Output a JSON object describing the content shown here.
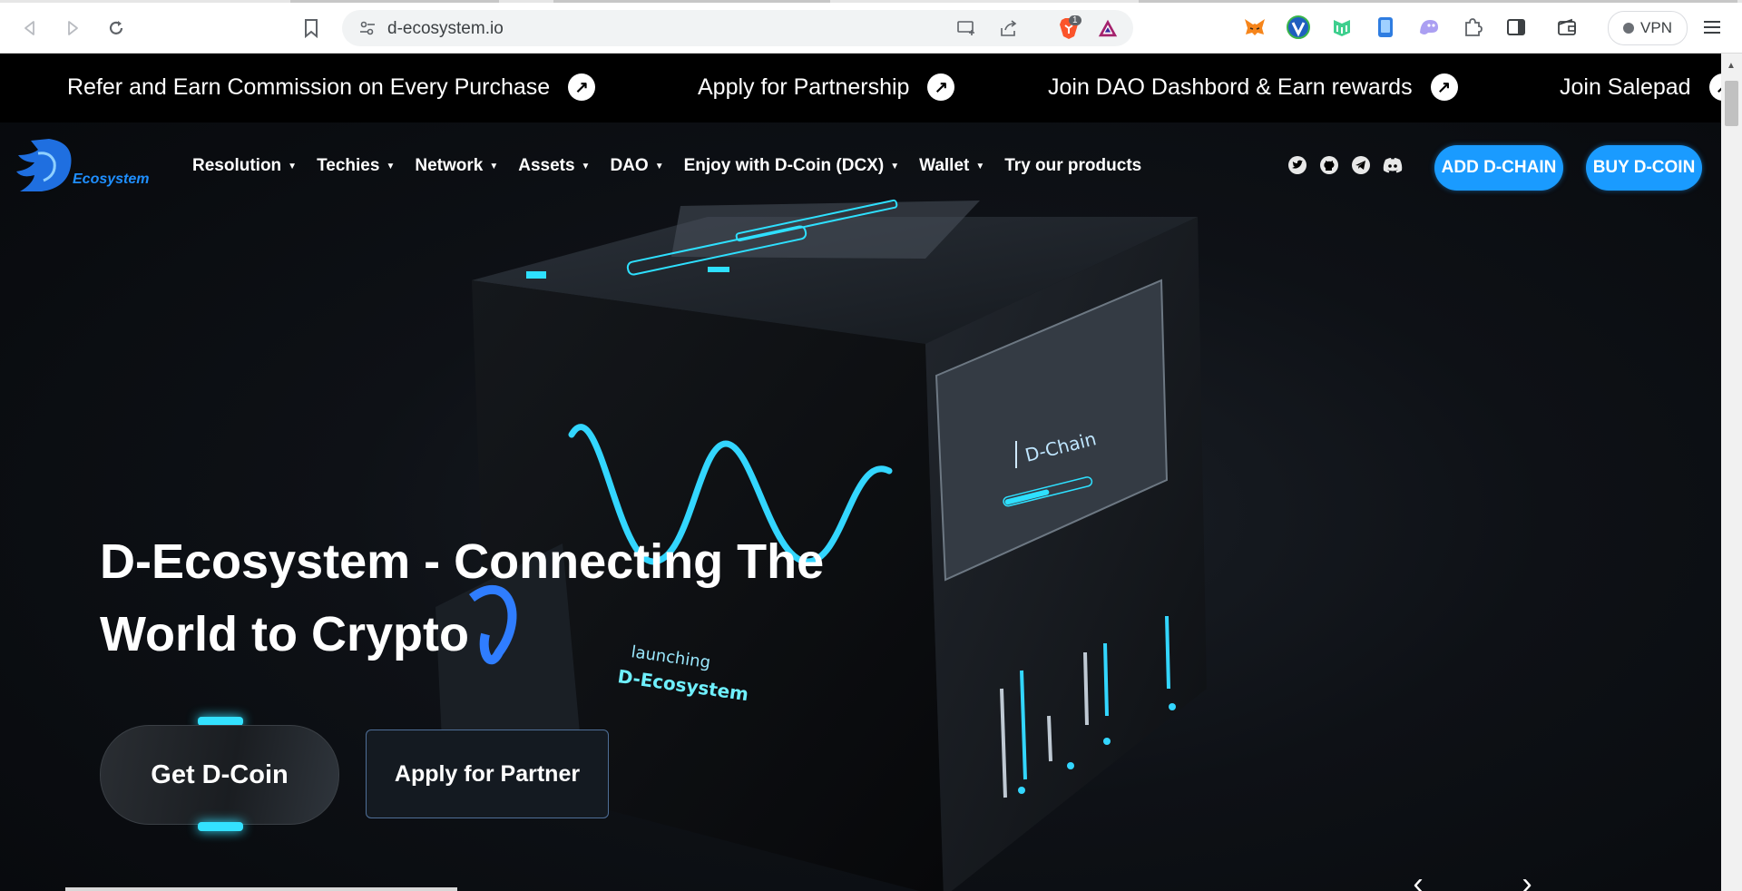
{
  "browser": {
    "url": "d-ecosystem.io",
    "brave_badge_count": "1",
    "vpn_label": "VPN"
  },
  "ticker": {
    "items": [
      "Refer and Earn Commission on Every Purchase",
      "Apply for Partnership",
      "Join DAO Dashbord & Earn rewards",
      "Join Salepad"
    ]
  },
  "nav": {
    "logo_text": "Ecosystem",
    "menu": [
      {
        "label": "Resolution",
        "dropdown": true
      },
      {
        "label": "Techies",
        "dropdown": true
      },
      {
        "label": "Network",
        "dropdown": true
      },
      {
        "label": "Assets",
        "dropdown": true
      },
      {
        "label": "DAO",
        "dropdown": true
      },
      {
        "label": "Enjoy with D-Coin (DCX)",
        "dropdown": true
      },
      {
        "label": "Wallet",
        "dropdown": true
      },
      {
        "label": "Try our products",
        "dropdown": false
      }
    ],
    "social_icons": [
      "twitter-icon",
      "github-icon",
      "telegram-icon",
      "discord-icon"
    ],
    "add_chain_label": "ADD D-CHAIN",
    "buy_coin_label": "BUY D-COIN"
  },
  "hero": {
    "title_line1": "D-Ecosystem - Connecting The",
    "title_line2": "World to Crypto",
    "get_coin_label": "Get D-Coin",
    "partner_label": "Apply for Partner",
    "screen_label": "D-Chain",
    "cube_text_small": "launching",
    "cube_text_big": "D-Ecosystem"
  },
  "colors": {
    "accent_blue": "#1a9bff",
    "glow_cyan": "#33e1ff",
    "ticker_bg": "#000000"
  }
}
